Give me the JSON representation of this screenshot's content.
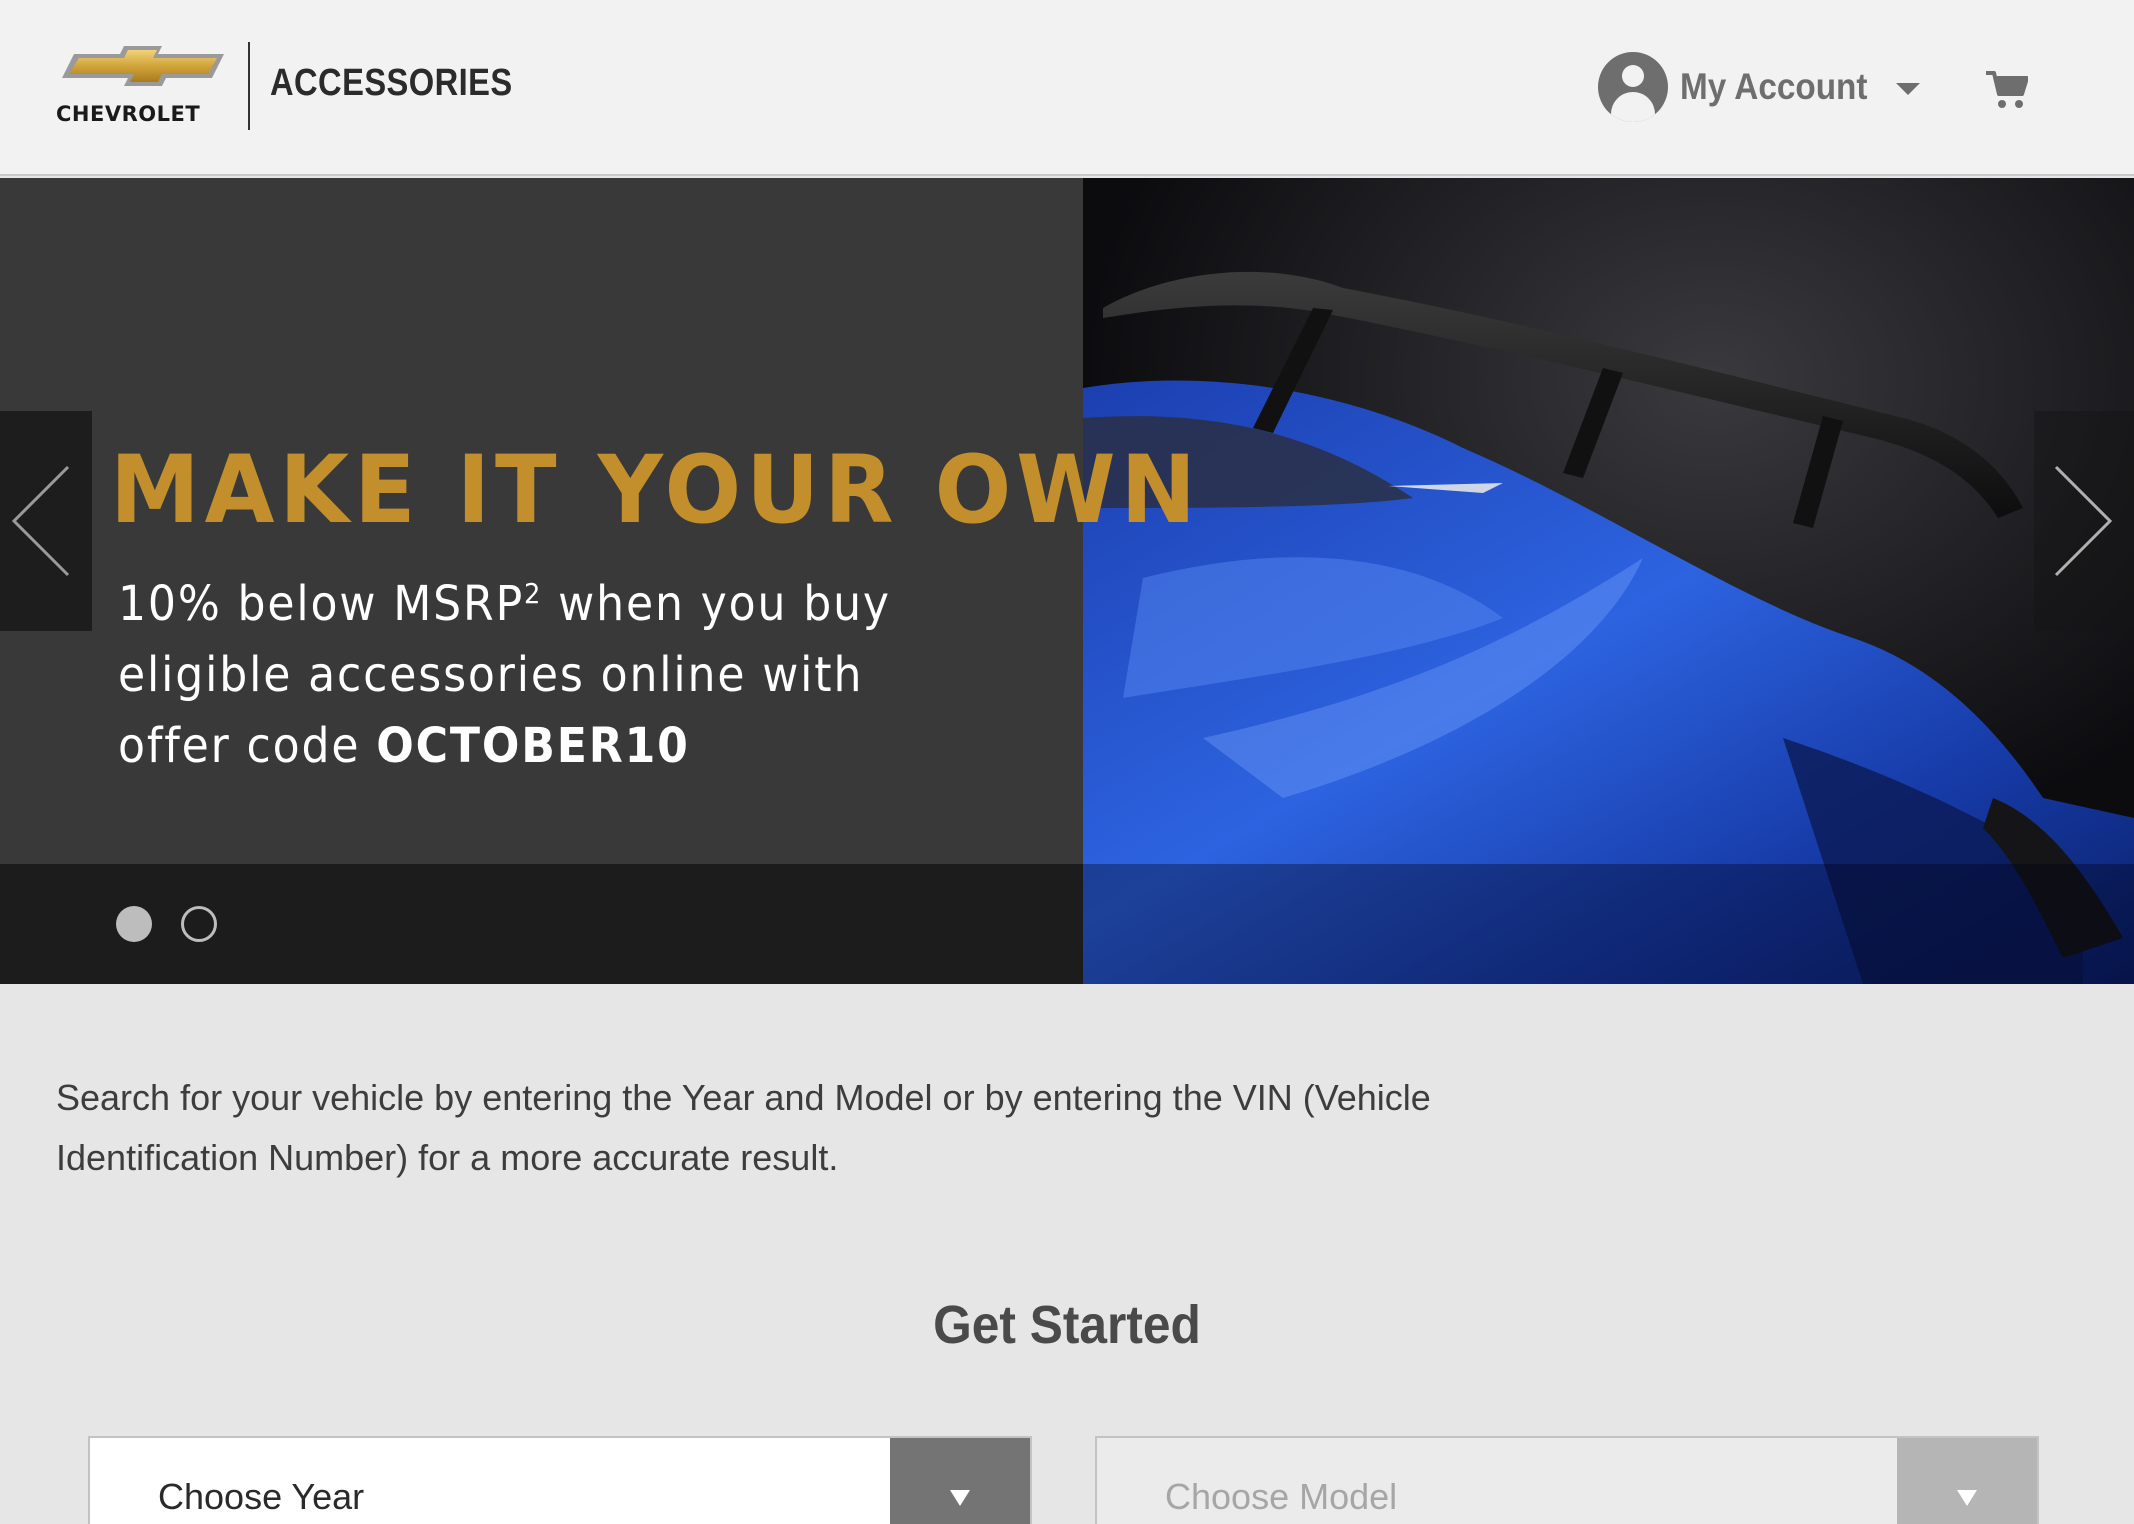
{
  "header": {
    "brand_name": "CHEVROLET",
    "section_title": "ACCESSORIES",
    "account_label": "My Account",
    "cart_icon": "cart-icon",
    "account_icon": "user-circle-icon"
  },
  "hero": {
    "headline": "MAKE IT YOUR OWN",
    "subtext_line1": "10% below MSRP",
    "superscript": "2",
    "subtext_line2": " when you buy eligible accessories online with offer code ",
    "offer_code": "OCTOBER10",
    "slide_count": 2,
    "active_slide": 1,
    "accent_color": "#c38f2c"
  },
  "intro": {
    "text": "Search for your vehicle by entering the Year and Model or by entering the VIN (Vehicle Identification Number) for a more accurate result."
  },
  "get_started": {
    "title": "Get Started",
    "year_select": {
      "value": "Choose Year"
    },
    "model_select": {
      "value": "Choose Model"
    }
  }
}
